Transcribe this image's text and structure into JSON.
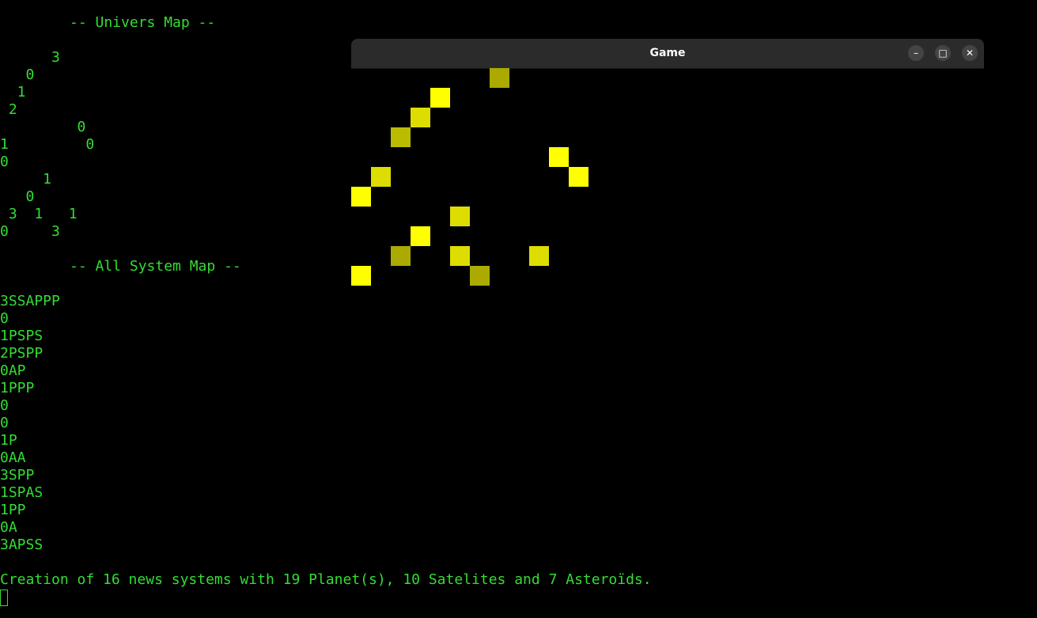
{
  "terminal": {
    "univers_header": "-- Univers Map --",
    "univers_lines": [
      "      3",
      "   0",
      "  1",
      " 2",
      "         0",
      "1         0",
      "0",
      "     1",
      "   0",
      " 3  1   1",
      "0     3"
    ],
    "system_header": "-- All System Map --",
    "system_lines": [
      "3SSAPPP",
      "0",
      "1PSPS",
      "2PSPP",
      "0AP",
      "1PPP",
      "0",
      "0",
      "1P",
      "0AA",
      "3SPP",
      "1SPAS",
      "1PP",
      "0A",
      "3APSS"
    ],
    "summary": "Creation of 16 news systems with 19 Planet(s), 10 Satelites and 7 Asteroïds."
  },
  "game_window": {
    "title": "Game",
    "buttons": {
      "minimize": "–",
      "maximize": "□",
      "close": "✕"
    },
    "cells": [
      {
        "col": 7,
        "row": 0,
        "color": "#aaaa00"
      },
      {
        "col": 4,
        "row": 1,
        "color": "#ffff00"
      },
      {
        "col": 3,
        "row": 2,
        "color": "#dddd00"
      },
      {
        "col": 2,
        "row": 3,
        "color": "#bbbb00"
      },
      {
        "col": 10,
        "row": 4,
        "color": "#ffff00"
      },
      {
        "col": 1,
        "row": 5,
        "color": "#dddd00"
      },
      {
        "col": 11,
        "row": 5,
        "color": "#ffff00"
      },
      {
        "col": 0,
        "row": 6,
        "color": "#ffff00"
      },
      {
        "col": 5,
        "row": 7,
        "color": "#dddd00"
      },
      {
        "col": 3,
        "row": 8,
        "color": "#ffff00"
      },
      {
        "col": 2,
        "row": 9,
        "color": "#aaaa00"
      },
      {
        "col": 5,
        "row": 9,
        "color": "#dddd00"
      },
      {
        "col": 9,
        "row": 9,
        "color": "#dddd00"
      },
      {
        "col": 0,
        "row": 10,
        "color": "#ffff00"
      },
      {
        "col": 6,
        "row": 10,
        "color": "#aaaa00"
      }
    ]
  },
  "colors": {
    "terminal_text": "#33dd33",
    "background": "#000000",
    "titlebar": "#2b2b2b"
  }
}
